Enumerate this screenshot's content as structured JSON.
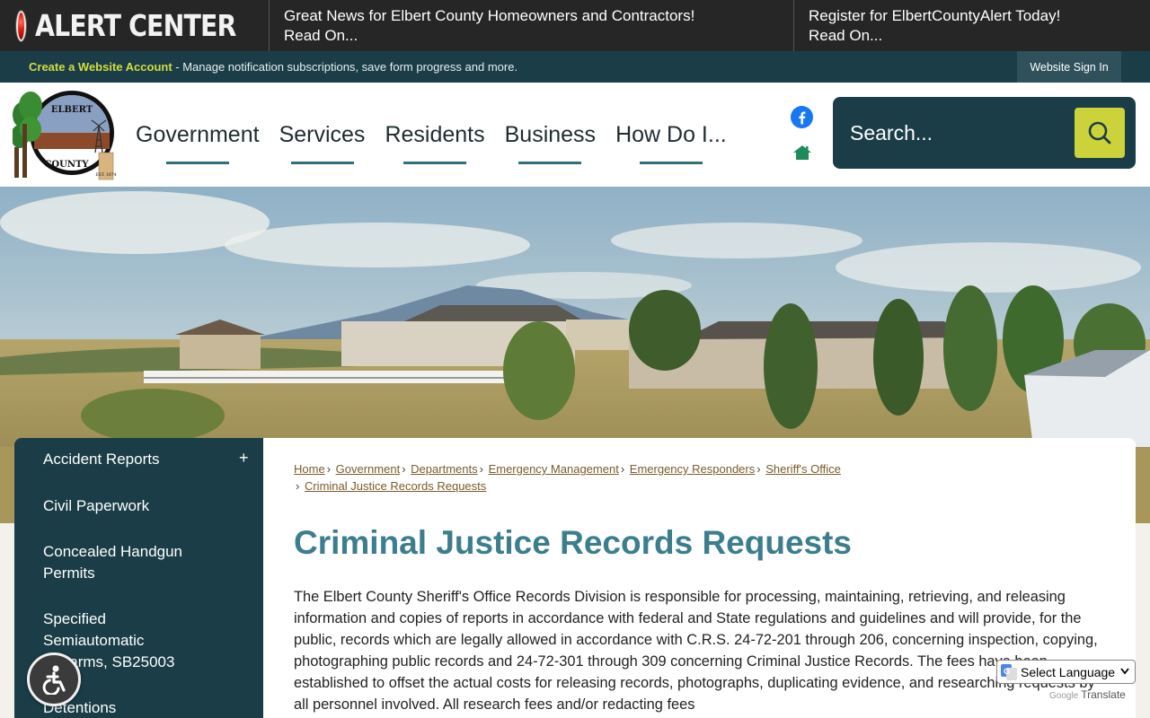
{
  "alert": {
    "title": "ALERT CENTER",
    "items": [
      {
        "headline": "Great News for Elbert County Homeowners and Contractors!",
        "more": "Read On..."
      },
      {
        "headline": "Register for ElbertCountyAlert Today!",
        "more": "Read On..."
      }
    ]
  },
  "account_bar": {
    "link": "Create a Website Account",
    "text": " - Manage notification subscriptions, save form progress and more.",
    "sign_in": "Website Sign In"
  },
  "logo": {
    "top": "ELBERT",
    "bottom": "COUNTY",
    "est": "EST. 1874"
  },
  "nav": [
    "Government",
    "Services",
    "Residents",
    "Business",
    "How Do I..."
  ],
  "social": {
    "facebook_icon": "facebook-icon",
    "home_icon": "home-icon"
  },
  "search": {
    "placeholder": "Search...",
    "icon": "search-icon"
  },
  "sidebar": {
    "items": [
      {
        "label": "Accident Reports",
        "toggle": "+"
      },
      {
        "label": "Civil Paperwork"
      },
      {
        "label": "Concealed Handgun Permits"
      },
      {
        "label": "Specified Semiautomatic Firearms, SB25003"
      },
      {
        "label": "Detentions"
      }
    ]
  },
  "breadcrumb": [
    "Home",
    "Government",
    "Departments",
    "Emergency Management",
    "Emergency Responders",
    "Sheriff's Office",
    "Criminal Justice Records Requests"
  ],
  "page": {
    "title": "Criminal Justice Records Requests",
    "body": "The Elbert County Sheriff's Office Records Division is responsible for processing, maintaining, retrieving, and releasing information and copies of reports in accordance with federal and State regulations and guidelines and will provide, for the public, records which are legally allowed in accordance with C.R.S. 24-72-201 through 206, concerning inspection, copying, photographing public records and 24-72-301 through 309 concerning Criminal Justice Records. The fees have been established to offset the actual costs for releasing records, photographs, duplicating evidence, and researching requests by all personnel involved. All research fees and/or redacting fees"
  },
  "translate": {
    "select_label": "Select Language",
    "powered_by": "Google",
    "translate_label": "Translate"
  },
  "colors": {
    "primary": "#1b3d47",
    "accent": "#ccd23a",
    "title": "#3c7e8d",
    "link": "#7a5b2c"
  }
}
